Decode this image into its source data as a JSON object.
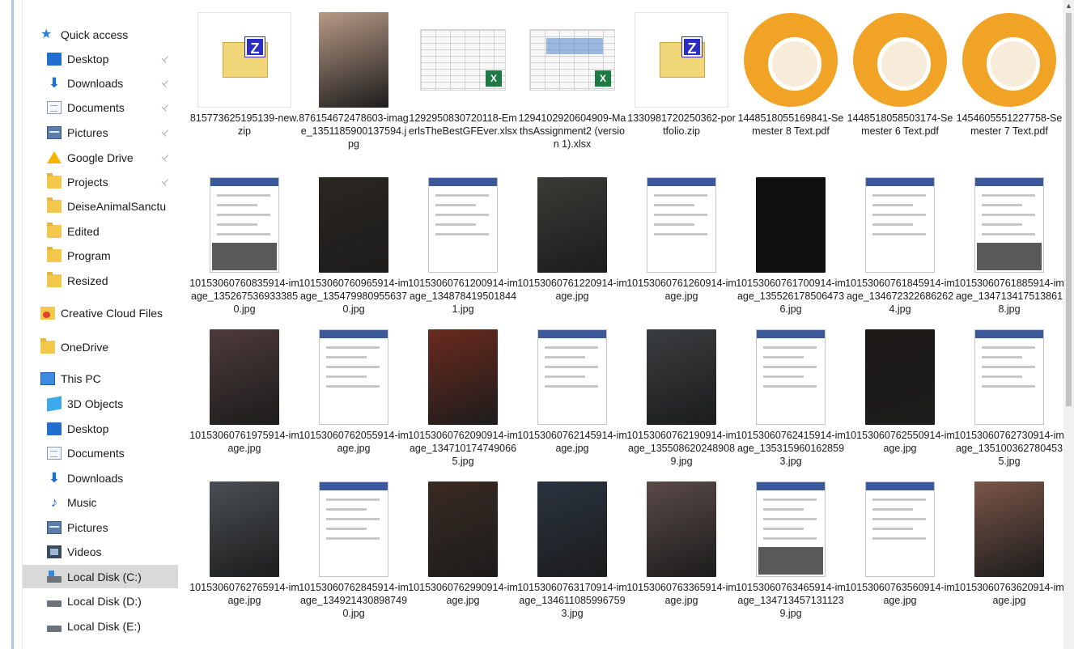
{
  "nav": {
    "items": [
      {
        "label": "Quick access",
        "icon": "quick-access-star-icon",
        "pinned": false,
        "indent": 1
      },
      {
        "label": "Desktop",
        "icon": "desktop-icon",
        "pinned": true,
        "indent": 2
      },
      {
        "label": "Downloads",
        "icon": "downloads-arrow-icon",
        "pinned": true,
        "indent": 2
      },
      {
        "label": "Documents",
        "icon": "documents-icon",
        "pinned": true,
        "indent": 2
      },
      {
        "label": "Pictures",
        "icon": "pictures-icon",
        "pinned": true,
        "indent": 2
      },
      {
        "label": "Google Drive",
        "icon": "google-drive-icon",
        "pinned": true,
        "indent": 2
      },
      {
        "label": "Projects",
        "icon": "folder-icon",
        "pinned": true,
        "indent": 2
      },
      {
        "label": "DeiseAnimalSanctu",
        "icon": "folder-icon",
        "pinned": false,
        "indent": 2
      },
      {
        "label": "Edited",
        "icon": "folder-icon",
        "pinned": false,
        "indent": 2
      },
      {
        "label": "Program",
        "icon": "folder-icon",
        "pinned": false,
        "indent": 2
      },
      {
        "label": "Resized",
        "icon": "folder-icon",
        "pinned": false,
        "indent": 2
      },
      {
        "label": "Creative Cloud Files",
        "icon": "creative-cloud-folder-icon",
        "pinned": false,
        "indent": 1
      },
      {
        "label": "OneDrive",
        "icon": "onedrive-folder-icon",
        "pinned": false,
        "indent": 1
      },
      {
        "label": "This PC",
        "icon": "this-pc-icon",
        "pinned": false,
        "indent": 1
      },
      {
        "label": "3D Objects",
        "icon": "3d-objects-icon",
        "pinned": false,
        "indent": 2
      },
      {
        "label": "Desktop",
        "icon": "desktop-icon",
        "pinned": false,
        "indent": 2
      },
      {
        "label": "Documents",
        "icon": "documents-icon",
        "pinned": false,
        "indent": 2
      },
      {
        "label": "Downloads",
        "icon": "downloads-arrow-icon",
        "pinned": false,
        "indent": 2
      },
      {
        "label": "Music",
        "icon": "music-note-icon",
        "pinned": false,
        "indent": 2
      },
      {
        "label": "Pictures",
        "icon": "pictures-icon",
        "pinned": false,
        "indent": 2
      },
      {
        "label": "Videos",
        "icon": "videos-icon",
        "pinned": false,
        "indent": 2
      },
      {
        "label": "Local Disk (C:)",
        "icon": "local-disk-c-icon",
        "pinned": false,
        "indent": 2,
        "selected": true
      },
      {
        "label": "Local Disk (D:)",
        "icon": "local-disk-icon",
        "pinned": false,
        "indent": 2
      },
      {
        "label": "Local Disk (E:)",
        "icon": "local-disk-icon",
        "pinned": false,
        "indent": 2
      }
    ]
  },
  "files": [
    {
      "name": "815773625195139-new.zip",
      "kind": "zip"
    },
    {
      "name": "876154672478603-image_1351185900137594.jpg",
      "kind": "photo",
      "color": "#b89a86"
    },
    {
      "name": "1292950830720118-EmerlsTheBestGFEver.xlsx",
      "kind": "xlsx"
    },
    {
      "name": "1294102920604909-MathsAssignment2 (version 1).xlsx",
      "kind": "xlsx2"
    },
    {
      "name": "1330981720250362-portfolio.zip",
      "kind": "zip"
    },
    {
      "name": "1448518055169841-Semester 8 Text.pdf",
      "kind": "pdf"
    },
    {
      "name": "1448518058503174-Semester 6 Text.pdf",
      "kind": "pdf"
    },
    {
      "name": "1454605551227758-Semester 7 Text.pdf",
      "kind": "pdf"
    },
    {
      "name": "10153060760835914-image_1352675369333850.jpg",
      "kind": "screen-kb"
    },
    {
      "name": "10153060760965914-image_1354799809556370.jpg",
      "kind": "photo",
      "color": "#2b2620"
    },
    {
      "name": "10153060761200914-image_1348784195018441.jpg",
      "kind": "screen"
    },
    {
      "name": "10153060761220914-image.jpg",
      "kind": "photo",
      "color": "#3a3a36"
    },
    {
      "name": "10153060761260914-image.jpg",
      "kind": "screen"
    },
    {
      "name": "10153060761700914-image_1355261785064736.jpg",
      "kind": "dark"
    },
    {
      "name": "10153060761845914-image_1346723226862624.jpg",
      "kind": "screen"
    },
    {
      "name": "10153060761885914-image_1347134175138618.jpg",
      "kind": "screen-kb"
    },
    {
      "name": "10153060761975914-image.jpg",
      "kind": "photo",
      "color": "#4e3a3a"
    },
    {
      "name": "10153060762055914-image.jpg",
      "kind": "screen"
    },
    {
      "name": "10153060762090914-image_1347101747490665.jpg",
      "kind": "photo",
      "color": "#6a2a1e"
    },
    {
      "name": "10153060762145914-image.jpg",
      "kind": "screen"
    },
    {
      "name": "10153060762190914-image_1355086202489089.jpg",
      "kind": "photo",
      "color": "#3a3d40"
    },
    {
      "name": "10153060762415914-image_1353159601628593.jpg",
      "kind": "screen"
    },
    {
      "name": "10153060762550914-image.jpg",
      "kind": "photo",
      "color": "#1e1a18"
    },
    {
      "name": "10153060762730914-image_1351003627804535.jpg",
      "kind": "screen"
    },
    {
      "name": "10153060762765914-image.jpg",
      "kind": "photo",
      "color": "#4a4f55"
    },
    {
      "name": "10153060762845914-image_1349214308987490.jpg",
      "kind": "screen"
    },
    {
      "name": "10153060762990914-image.jpg",
      "kind": "photo",
      "color": "#3a2a22"
    },
    {
      "name": "10153060763170914-image_1346110859967593.jpg",
      "kind": "photo",
      "color": "#2a3340"
    },
    {
      "name": "10153060763365914-image.jpg",
      "kind": "photo",
      "color": "#5a4a48"
    },
    {
      "name": "10153060763465914-image_1347134571311239.jpg",
      "kind": "screen-kb"
    },
    {
      "name": "10153060763560914-image.jpg",
      "kind": "screen"
    },
    {
      "name": "10153060763620914-image.jpg",
      "kind": "photo",
      "color": "#7a5548"
    }
  ],
  "pdf_color": "#f1a325",
  "accent_color": "#1e6fcf",
  "selected_color": "#d9d9d9"
}
